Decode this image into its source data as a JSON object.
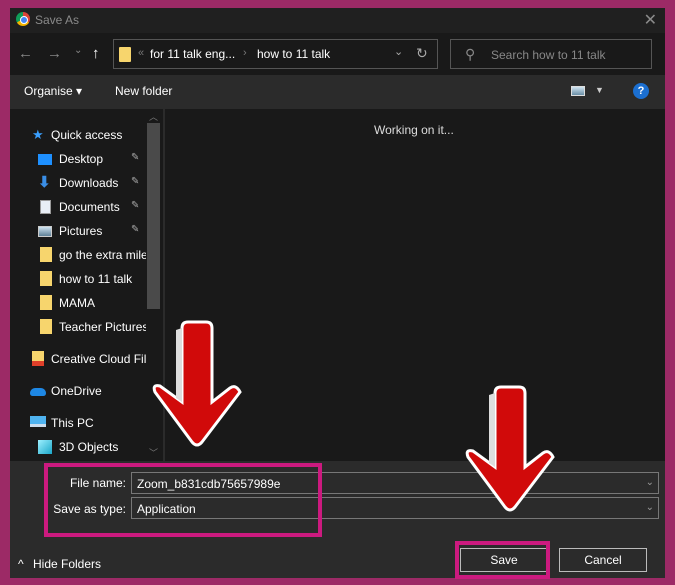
{
  "window": {
    "title": "Save As",
    "close_glyph": "✕"
  },
  "nav": {
    "back_glyph": "←",
    "forward_glyph": "→",
    "recent_glyph": "⌄",
    "up_glyph": "↑",
    "breadcrumb": [
      "for 11 talk eng...",
      "how to 11 talk"
    ],
    "overflow_glyph": "«",
    "sep_glyph": "›",
    "address_dropdown_glyph": "⌄",
    "refresh_glyph": "↻",
    "search_placeholder": "Search how to 11 talk",
    "search_glyph": "⚲"
  },
  "toolbar": {
    "organise_label": "Organise ▾",
    "new_folder_label": "New folder",
    "view_caret": "▼",
    "help_glyph": "?"
  },
  "sidebar": {
    "items": [
      {
        "label": "Quick access",
        "icon": "star-icon",
        "pinned": false
      },
      {
        "label": "Desktop",
        "icon": "desktop-icon",
        "pinned": true
      },
      {
        "label": "Downloads",
        "icon": "download-icon",
        "pinned": true
      },
      {
        "label": "Documents",
        "icon": "document-icon",
        "pinned": true
      },
      {
        "label": "Pictures",
        "icon": "pictures-icon",
        "pinned": true
      },
      {
        "label": "go the extra mile",
        "icon": "folder-icon",
        "pinned": false
      },
      {
        "label": "how to 11 talk",
        "icon": "folder-icon",
        "pinned": false
      },
      {
        "label": "MAMA",
        "icon": "folder-icon",
        "pinned": false
      },
      {
        "label": "Teacher Pictures",
        "icon": "folder-icon",
        "pinned": false
      },
      {
        "label": "Creative Cloud Fil",
        "icon": "creative-cloud-icon",
        "pinned": false
      },
      {
        "label": "OneDrive",
        "icon": "onedrive-icon",
        "pinned": false
      },
      {
        "label": "This PC",
        "icon": "pc-icon",
        "pinned": false
      },
      {
        "label": "3D Objects",
        "icon": "3d-objects-icon",
        "pinned": false
      }
    ],
    "pin_glyph": "📌"
  },
  "main": {
    "status": "Working on it..."
  },
  "form": {
    "file_name_label": "File name:",
    "file_name_value": "Zoom_b831cdb75657989e",
    "save_type_label": "Save as type:",
    "save_type_value": "Application",
    "dropdown_glyph": "⌄"
  },
  "footer": {
    "hide_folders_label": "Hide Folders",
    "hide_glyph": "^",
    "save_label": "Save",
    "cancel_label": "Cancel"
  },
  "colors": {
    "highlight": "#cc1a7f",
    "arrow": "#d10a0a",
    "frame": "#9c2a66"
  }
}
